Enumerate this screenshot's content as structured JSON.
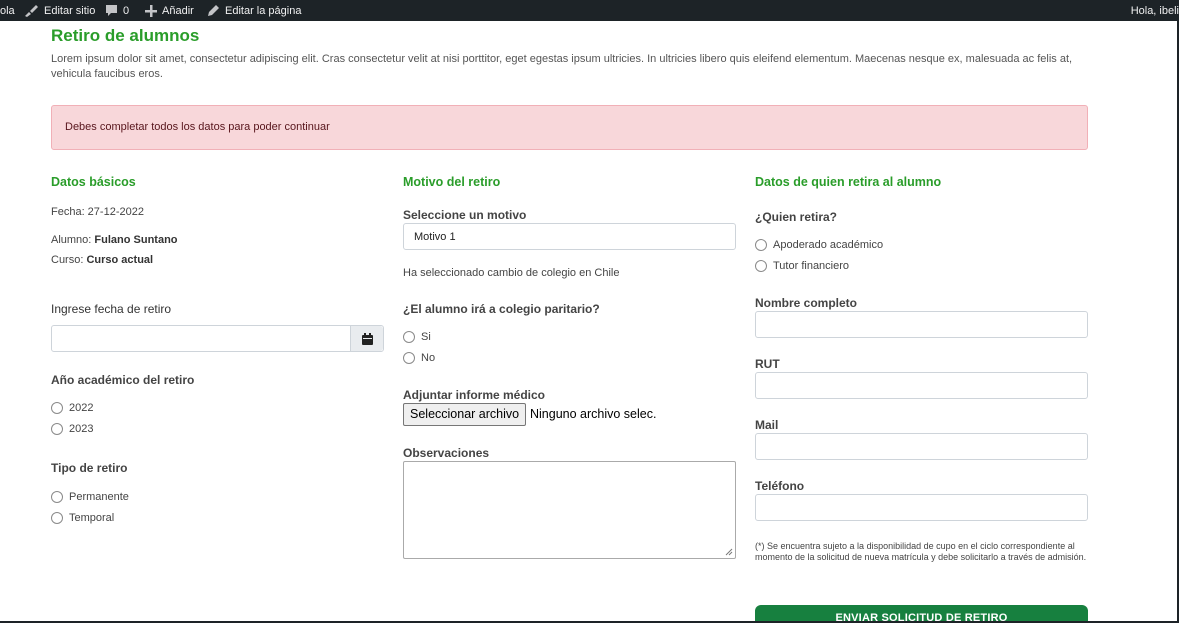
{
  "adminbar": {
    "site_prefix": "ola",
    "edit_site": "Editar sitio",
    "comments_count": "0",
    "add_new": "Añadir",
    "edit_page": "Editar la página",
    "greeting": "Hola, ibeli"
  },
  "page": {
    "title": "Retiro de alumnos",
    "intro": "Lorem ipsum dolor sit amet, consectetur adipiscing elit. Cras consectetur velit at nisi porttitor, eget egestas ipsum ultricies. In ultricies libero quis eleifend elementum. Maecenas nesque ex, malesuada ac felis at, vehicula faucibus eros.",
    "alert": "Debes completar todos los datos para poder continuar"
  },
  "basic": {
    "title": "Datos básicos",
    "date_label": "Fecha: 27-12-2022",
    "student_prefix": "Alumno: ",
    "student_name": "Fulano Suntano",
    "course_prefix": "Curso: ",
    "course_name": "Curso actual",
    "withdraw_date_label": "Ingrese fecha de retiro",
    "withdraw_date_value": "",
    "year_label": "Año académico del retiro",
    "years": [
      "2022",
      "2023"
    ],
    "type_label": "Tipo de retiro",
    "types": [
      "Permanente",
      "Temporal"
    ]
  },
  "reason": {
    "title": "Motivo del retiro",
    "select_label": "Seleccione un motivo",
    "select_value": "Motivo 1",
    "selected_info": "Ha seleccionado cambio de colegio en Chile",
    "paritario_label": "¿El alumno irá a colegio paritario?",
    "paritario_options": [
      "Si",
      "No"
    ],
    "attach_label": "Adjuntar informe médico",
    "file_button": "Seleccionar archivo",
    "file_status": "Ninguno archivo selec.",
    "observations_label": "Observaciones",
    "observations_value": ""
  },
  "guardian": {
    "title": "Datos de quien retira al alumno",
    "who_label": "¿Quien retira?",
    "who_options": [
      "Apoderado académico",
      "Tutor financiero"
    ],
    "name_label": "Nombre completo",
    "rut_label": "RUT",
    "mail_label": "Mail",
    "phone_label": "Teléfono",
    "note": "(*) Se encuentra sujeto a la disponibilidad de cupo en el ciclo correspondiente al momento de la solicitud de nueva matrícula y debe solicitarlo a través de admisión.",
    "submit": "ENVIAR SOLICITUD DE RETIRO"
  },
  "colors": {
    "accent_green": "#2a9d2a",
    "alert_bg": "#f8d7da",
    "admin_bar": "#1d2327",
    "submit_bg": "#17803f"
  },
  "icons": {
    "edit_site": "brush-icon",
    "comments": "comment-icon",
    "add": "plus-icon",
    "edit_page": "pencil-icon",
    "calendar": "calendar-icon"
  }
}
